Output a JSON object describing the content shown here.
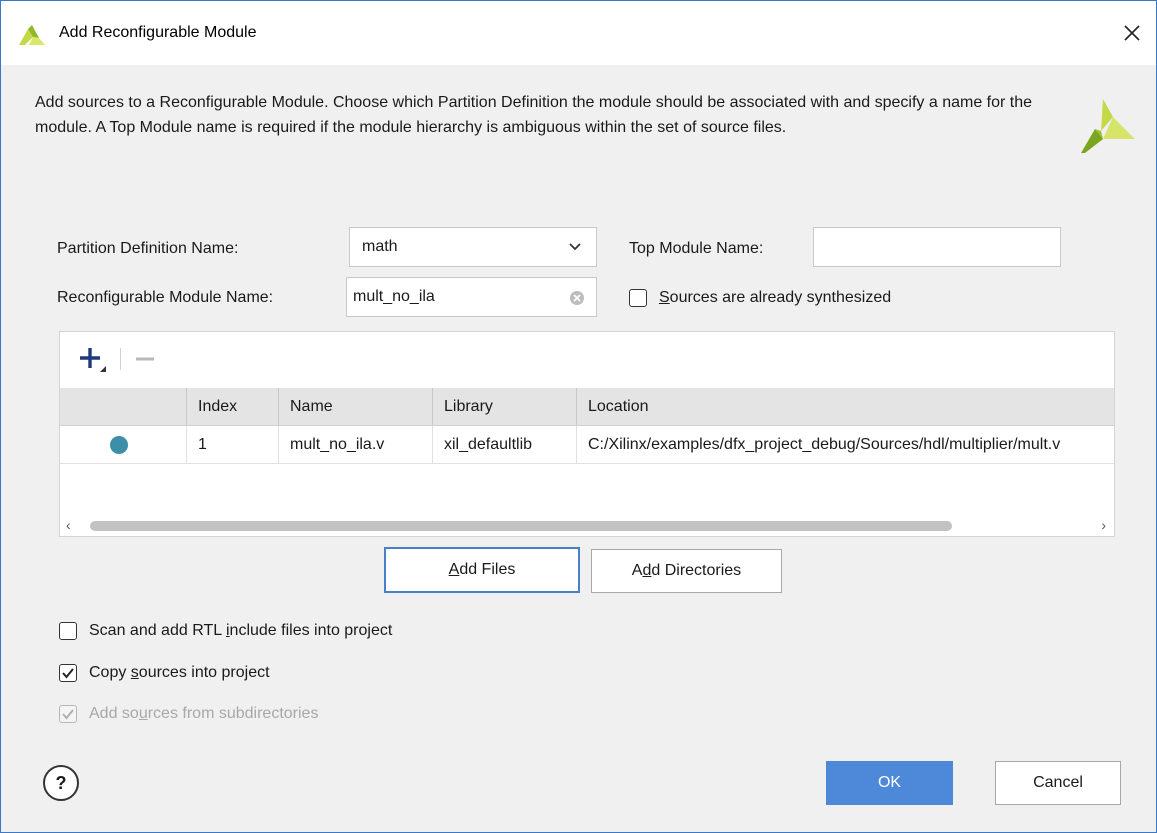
{
  "window": {
    "title": "Add Reconfigurable Module",
    "close_icon": "close-icon"
  },
  "intro": {
    "text": "Add sources to a Reconfigurable Module. Choose which Partition Definition the module should be associated with and specify a name for the module. A Top Module name is required if the module hierarchy is ambiguous within the set of source files."
  },
  "form": {
    "partition_label": "Partition Definition Name:",
    "partition_value": "math",
    "top_module_label": "Top Module Name:",
    "top_module_value": "",
    "rm_name_label": "Reconfigurable Module Name:",
    "rm_name_value": "mult_no_ila",
    "synth_label_pre": "",
    "synth_label_mn": "S",
    "synth_label_post": "ources are already synthesized",
    "synth_checked": false
  },
  "table": {
    "columns": [
      "",
      "Index",
      "Name",
      "Library",
      "Location"
    ],
    "rows": [
      {
        "status_icon": "source-file-dot",
        "index": "1",
        "name": "mult_no_ila.v",
        "library": "xil_defaultlib",
        "location": "C:/Xilinx/examples/dfx_project_debug/Sources/hdl/multiplier/mult.v"
      }
    ],
    "scroll_left": "‹",
    "scroll_right": "›"
  },
  "buttons": {
    "add_files_mn": "A",
    "add_files_rest": "dd Files",
    "add_dirs_pre": "A",
    "add_dirs_mn": "d",
    "add_dirs_rest": "d Directories",
    "ok": "OK",
    "cancel": "Cancel",
    "help": "?"
  },
  "options": {
    "scan_pre": "Scan and add RTL ",
    "scan_mn": "i",
    "scan_post": "nclude files into project",
    "scan_checked": false,
    "copy_pre": "Copy ",
    "copy_mn": "s",
    "copy_post": "ources into project",
    "copy_checked": true,
    "subdir_pre": "Add so",
    "subdir_mn": "u",
    "subdir_post": "rces from subdirectories",
    "subdir_checked": true,
    "subdir_enabled": false
  },
  "colors": {
    "accent": "#4e88d8",
    "focus_border": "#4a80c8",
    "status_dot": "#3d8fa8",
    "logo_light": "#c5d84a",
    "logo_dark": "#7aa51e"
  }
}
